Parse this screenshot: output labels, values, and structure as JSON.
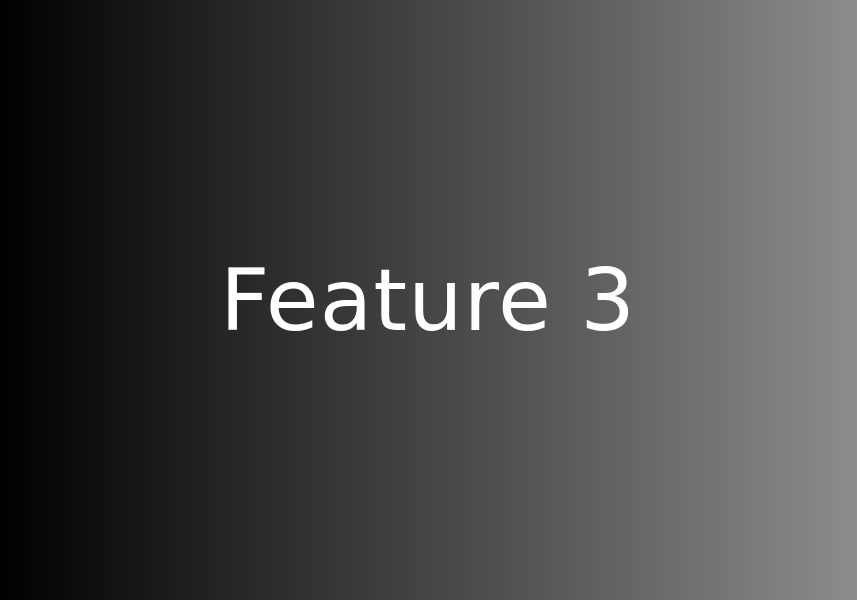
{
  "banner": {
    "title": "Feature 3",
    "text_color": "#ffffff",
    "gradient_colors": [
      "#000000",
      "#8c8c8c"
    ]
  }
}
